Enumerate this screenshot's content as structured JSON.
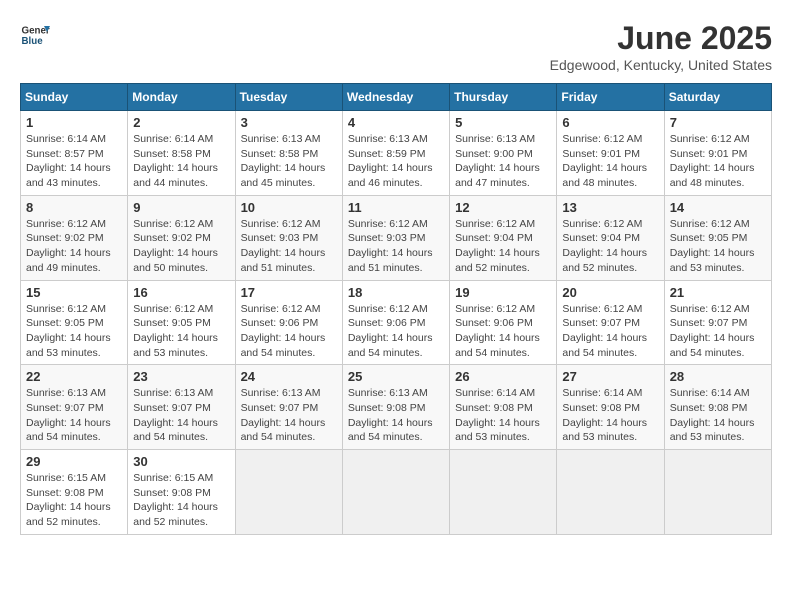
{
  "header": {
    "logo_general": "General",
    "logo_blue": "Blue",
    "title": "June 2025",
    "subtitle": "Edgewood, Kentucky, United States"
  },
  "calendar": {
    "days_of_week": [
      "Sunday",
      "Monday",
      "Tuesday",
      "Wednesday",
      "Thursday",
      "Friday",
      "Saturday"
    ],
    "weeks": [
      [
        null,
        null,
        null,
        null,
        null,
        null,
        null
      ]
    ],
    "cells": [
      {
        "day": 1,
        "sunrise": "6:14 AM",
        "sunset": "8:57 PM",
        "daylight": "14 hours and 43 minutes."
      },
      {
        "day": 2,
        "sunrise": "6:14 AM",
        "sunset": "8:58 PM",
        "daylight": "14 hours and 44 minutes."
      },
      {
        "day": 3,
        "sunrise": "6:13 AM",
        "sunset": "8:58 PM",
        "daylight": "14 hours and 45 minutes."
      },
      {
        "day": 4,
        "sunrise": "6:13 AM",
        "sunset": "8:59 PM",
        "daylight": "14 hours and 46 minutes."
      },
      {
        "day": 5,
        "sunrise": "6:13 AM",
        "sunset": "9:00 PM",
        "daylight": "14 hours and 47 minutes."
      },
      {
        "day": 6,
        "sunrise": "6:12 AM",
        "sunset": "9:01 PM",
        "daylight": "14 hours and 48 minutes."
      },
      {
        "day": 7,
        "sunrise": "6:12 AM",
        "sunset": "9:01 PM",
        "daylight": "14 hours and 48 minutes."
      },
      {
        "day": 8,
        "sunrise": "6:12 AM",
        "sunset": "9:02 PM",
        "daylight": "14 hours and 49 minutes."
      },
      {
        "day": 9,
        "sunrise": "6:12 AM",
        "sunset": "9:02 PM",
        "daylight": "14 hours and 50 minutes."
      },
      {
        "day": 10,
        "sunrise": "6:12 AM",
        "sunset": "9:03 PM",
        "daylight": "14 hours and 51 minutes."
      },
      {
        "day": 11,
        "sunrise": "6:12 AM",
        "sunset": "9:03 PM",
        "daylight": "14 hours and 51 minutes."
      },
      {
        "day": 12,
        "sunrise": "6:12 AM",
        "sunset": "9:04 PM",
        "daylight": "14 hours and 52 minutes."
      },
      {
        "day": 13,
        "sunrise": "6:12 AM",
        "sunset": "9:04 PM",
        "daylight": "14 hours and 52 minutes."
      },
      {
        "day": 14,
        "sunrise": "6:12 AM",
        "sunset": "9:05 PM",
        "daylight": "14 hours and 53 minutes."
      },
      {
        "day": 15,
        "sunrise": "6:12 AM",
        "sunset": "9:05 PM",
        "daylight": "14 hours and 53 minutes."
      },
      {
        "day": 16,
        "sunrise": "6:12 AM",
        "sunset": "9:05 PM",
        "daylight": "14 hours and 53 minutes."
      },
      {
        "day": 17,
        "sunrise": "6:12 AM",
        "sunset": "9:06 PM",
        "daylight": "14 hours and 54 minutes."
      },
      {
        "day": 18,
        "sunrise": "6:12 AM",
        "sunset": "9:06 PM",
        "daylight": "14 hours and 54 minutes."
      },
      {
        "day": 19,
        "sunrise": "6:12 AM",
        "sunset": "9:06 PM",
        "daylight": "14 hours and 54 minutes."
      },
      {
        "day": 20,
        "sunrise": "6:12 AM",
        "sunset": "9:07 PM",
        "daylight": "14 hours and 54 minutes."
      },
      {
        "day": 21,
        "sunrise": "6:12 AM",
        "sunset": "9:07 PM",
        "daylight": "14 hours and 54 minutes."
      },
      {
        "day": 22,
        "sunrise": "6:13 AM",
        "sunset": "9:07 PM",
        "daylight": "14 hours and 54 minutes."
      },
      {
        "day": 23,
        "sunrise": "6:13 AM",
        "sunset": "9:07 PM",
        "daylight": "14 hours and 54 minutes."
      },
      {
        "day": 24,
        "sunrise": "6:13 AM",
        "sunset": "9:07 PM",
        "daylight": "14 hours and 54 minutes."
      },
      {
        "day": 25,
        "sunrise": "6:13 AM",
        "sunset": "9:08 PM",
        "daylight": "14 hours and 54 minutes."
      },
      {
        "day": 26,
        "sunrise": "6:14 AM",
        "sunset": "9:08 PM",
        "daylight": "14 hours and 53 minutes."
      },
      {
        "day": 27,
        "sunrise": "6:14 AM",
        "sunset": "9:08 PM",
        "daylight": "14 hours and 53 minutes."
      },
      {
        "day": 28,
        "sunrise": "6:14 AM",
        "sunset": "9:08 PM",
        "daylight": "14 hours and 53 minutes."
      },
      {
        "day": 29,
        "sunrise": "6:15 AM",
        "sunset": "9:08 PM",
        "daylight": "14 hours and 52 minutes."
      },
      {
        "day": 30,
        "sunrise": "6:15 AM",
        "sunset": "9:08 PM",
        "daylight": "14 hours and 52 minutes."
      }
    ]
  }
}
